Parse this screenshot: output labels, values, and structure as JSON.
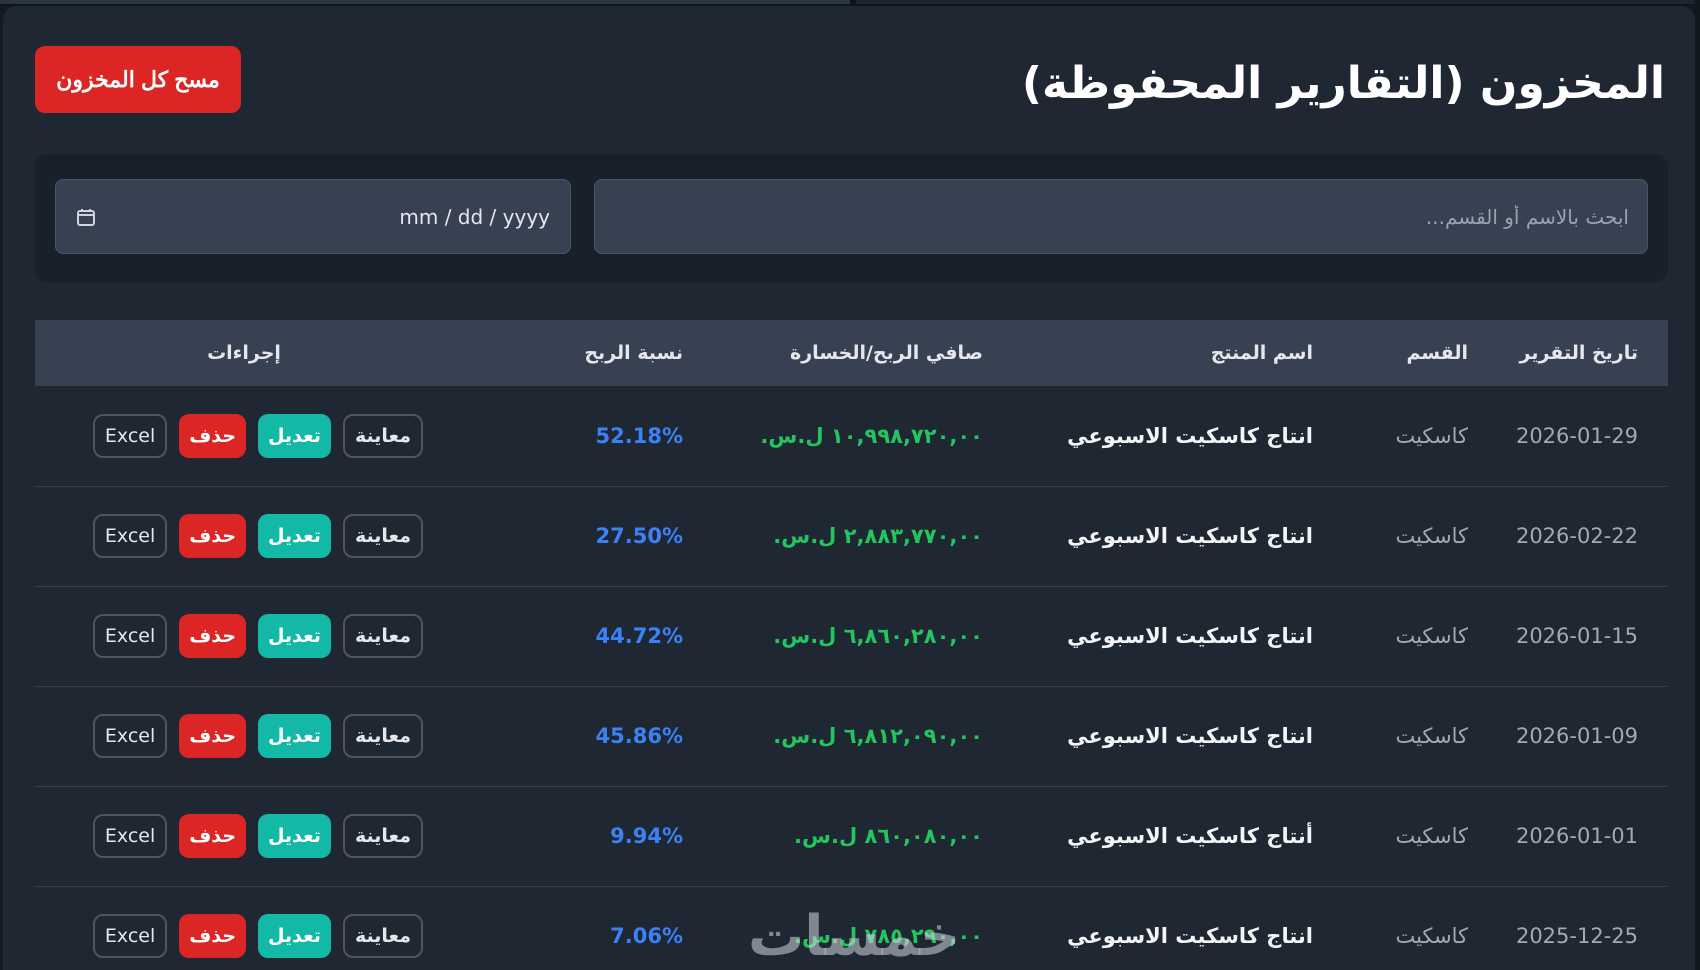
{
  "page": {
    "title": "المخزون (التقارير المحفوظة)",
    "clear_button": "مسح كل المخزون"
  },
  "filters": {
    "search_placeholder": "ابحث بالاسم أو القسم...",
    "date_placeholder": "mm / dd / yyyy",
    "date_icon": "calendar-icon"
  },
  "table": {
    "headers": {
      "date": "تاريخ التقرير",
      "department": "القسم",
      "product": "اسم المنتج",
      "net": "صافي الربح/الخسارة",
      "pct": "نسبة الربح",
      "actions": "إجراءات"
    },
    "action_labels": {
      "view": "معاينة",
      "edit": "تعديل",
      "delete": "حذف",
      "excel": "Excel"
    },
    "rows": [
      {
        "date": "2026-01-29",
        "department": "كاسكيت",
        "product": "انتاج كاسكيت الاسبوعي",
        "net": "١٠,٩٩٨,٧٢٠,٠٠ ل.س.",
        "pct": "52.18%"
      },
      {
        "date": "2026-02-22",
        "department": "كاسكيت",
        "product": "انتاج كاسكيت الاسبوعي",
        "net": "٢,٨٨٣,٧٧٠,٠٠ ل.س.",
        "pct": "27.50%"
      },
      {
        "date": "2026-01-15",
        "department": "كاسكيت",
        "product": "انتاج كاسكيت الاسبوعي",
        "net": "٦,٨٦٠,٢٨٠,٠٠ ل.س.",
        "pct": "44.72%"
      },
      {
        "date": "2026-01-09",
        "department": "كاسكيت",
        "product": "انتاج كاسكيت الاسبوعي",
        "net": "٦,٨١٢,٠٩٠,٠٠ ل.س.",
        "pct": "45.86%"
      },
      {
        "date": "2026-01-01",
        "department": "كاسكيت",
        "product": "أنتاج كاسكيت الاسبوعي",
        "net": "٨٦٠,٠٨٠,٠٠ ل.س.",
        "pct": "9.94%"
      },
      {
        "date": "2025-12-25",
        "department": "كاسكيت",
        "product": "انتاج كاسكيت الاسبوعي",
        "net": "٧٨٥,٢٩٠,٠٠ ل.س.",
        "pct": "7.06%"
      }
    ]
  },
  "watermark": "خمسات",
  "colors": {
    "background": "#1f2733",
    "danger": "#dc2626",
    "teal": "#14b8a6",
    "profit_green": "#22c55e",
    "percent_blue": "#3b82f6"
  }
}
